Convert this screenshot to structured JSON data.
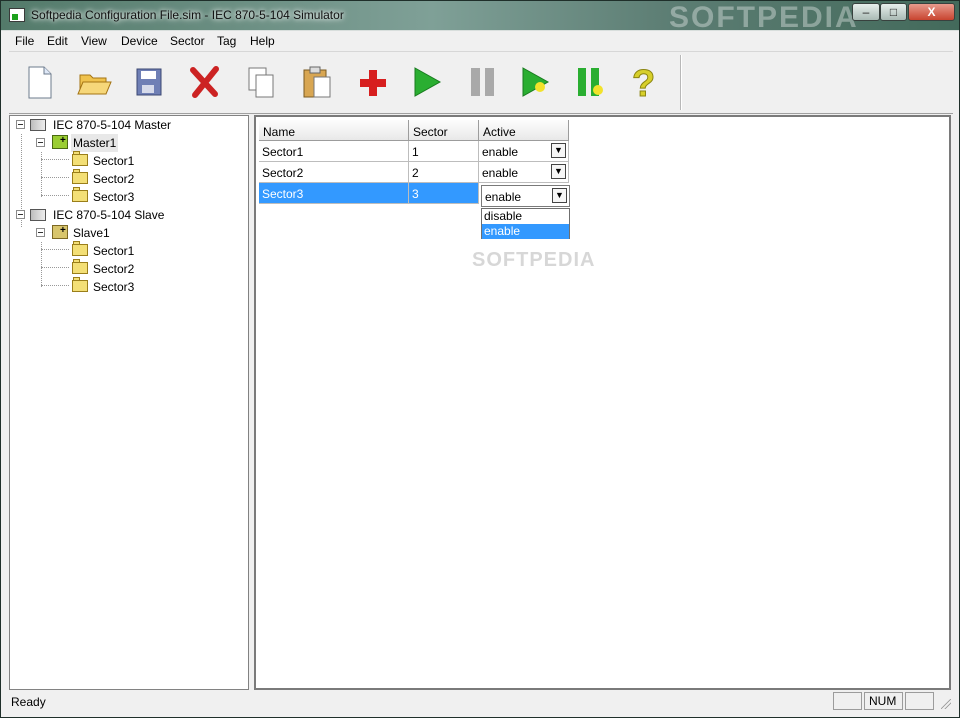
{
  "window": {
    "title": "Softpedia Configuration File.sim - IEC 870-5-104 Simulator",
    "watermark": "SOFTPEDIA"
  },
  "window_controls": {
    "minimize": "–",
    "maximize": "□",
    "close": "X"
  },
  "menu": [
    "File",
    "Edit",
    "View",
    "Device",
    "Sector",
    "Tag",
    "Help"
  ],
  "toolbar": {
    "icons": [
      "new-document-icon",
      "open-folder-icon",
      "save-disk-icon",
      "delete-icon",
      "copy-icon",
      "paste-icon",
      "add-icon",
      "play-icon",
      "pause-icon",
      "play-all-icon",
      "pause-all-icon",
      "help-icon"
    ],
    "help_label": "?"
  },
  "tree": {
    "master": {
      "label": "IEC 870-5-104 Master",
      "device": "Master1",
      "sectors": [
        "Sector1",
        "Sector2",
        "Sector3"
      ]
    },
    "slave": {
      "label": "IEC 870-5-104 Slave",
      "device": "Slave1",
      "sectors": [
        "Sector1",
        "Sector2",
        "Sector3"
      ]
    }
  },
  "table": {
    "columns": [
      "Name",
      "Sector",
      "Active"
    ],
    "rows": [
      {
        "name": "Sector1",
        "sector": "1",
        "active": "enable"
      },
      {
        "name": "Sector2",
        "sector": "2",
        "active": "enable"
      },
      {
        "name": "Sector3",
        "sector": "3",
        "active": "enable"
      }
    ]
  },
  "dropdown": {
    "arrow": "▼",
    "options": [
      "disable",
      "enable"
    ],
    "selected": "enable"
  },
  "statusbar": {
    "text": "Ready",
    "num": "NUM"
  },
  "colors": {
    "selection": "#3399ff"
  },
  "watermark_small": "SOFTPEDIA"
}
